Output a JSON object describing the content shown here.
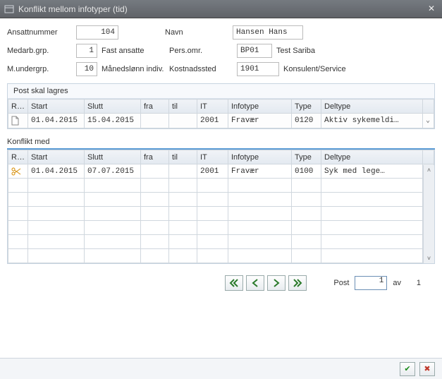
{
  "window": {
    "title": "Konflikt mellom infotyper (tid)"
  },
  "form": {
    "ansattnummer_label": "Ansattnummer",
    "ansattnummer": "104",
    "navn_label": "Navn",
    "navn": "Hansen Hans",
    "medarb_label": "Medarb.grp.",
    "medarb": "1",
    "medarb_text": "Fast ansatte",
    "persomr_label": "Pers.omr.",
    "persomr": "BP01",
    "persomr_text": "Test Sariba",
    "mundergrp_label": "M.undergrp.",
    "mundergrp": "10",
    "mundergrp_text": "Månedslønn indiv.",
    "kostnad_label": "Kostnadssted",
    "kostnad": "1901",
    "kostnad_text": "Konsulent/Service"
  },
  "panel1": {
    "title": "Post skal lagres",
    "headers": {
      "re": "Re...",
      "start": "Start",
      "slutt": "Slutt",
      "fra": "fra",
      "til": "til",
      "it": "IT",
      "infotype": "Infotype",
      "type": "Type",
      "deltype": "Deltype"
    },
    "row": {
      "start": "01.04.2015",
      "slutt": "15.04.2015",
      "fra": "",
      "til": "",
      "it": "2001",
      "infotype": "Fravær",
      "type": "0120",
      "deltype": "Aktiv sykemeldi…"
    }
  },
  "panel2": {
    "title": "Konflikt med",
    "headers": {
      "re": "Re...",
      "start": "Start",
      "slutt": "Slutt",
      "fra": "fra",
      "til": "til",
      "it": "IT",
      "infotype": "Infotype",
      "type": "Type",
      "deltype": "Deltype"
    },
    "row": {
      "start": "01.04.2015",
      "slutt": "07.07.2015",
      "fra": "",
      "til": "",
      "it": "2001",
      "infotype": "Fravær",
      "type": "0100",
      "deltype": "Syk med lege…"
    }
  },
  "nav": {
    "post_label": "Post",
    "post_value": "1",
    "av_label": "av",
    "total": "1"
  }
}
